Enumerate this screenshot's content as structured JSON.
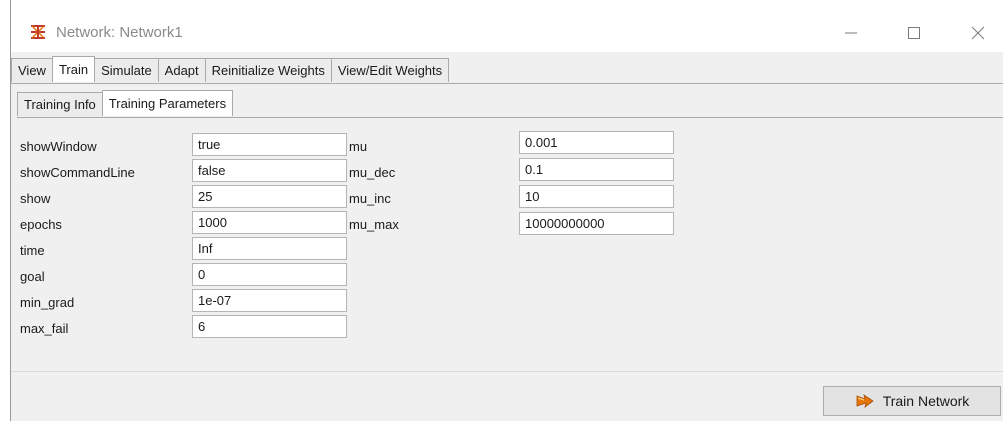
{
  "window": {
    "title": "Network: Network1"
  },
  "tabs": [
    "View",
    "Train",
    "Simulate",
    "Adapt",
    "Reinitialize Weights",
    "View/Edit Weights"
  ],
  "active_tab": "Train",
  "subtabs": [
    "Training Info",
    "Training Parameters"
  ],
  "active_subtab": "Training Parameters",
  "params_left": [
    {
      "label": "showWindow",
      "value": "true"
    },
    {
      "label": "showCommandLine",
      "value": "false"
    },
    {
      "label": "show",
      "value": "25"
    },
    {
      "label": "epochs",
      "value": "1000"
    },
    {
      "label": "time",
      "value": "Inf"
    },
    {
      "label": "goal",
      "value": "0"
    },
    {
      "label": "min_grad",
      "value": "1e-07"
    },
    {
      "label": "max_fail",
      "value": "6"
    }
  ],
  "params_right": [
    {
      "label": "mu",
      "value": "0.001"
    },
    {
      "label": "mu_dec",
      "value": "0.1"
    },
    {
      "label": "mu_inc",
      "value": "10"
    },
    {
      "label": "mu_max",
      "value": "10000000000"
    }
  ],
  "train_button": {
    "label": "Train Network",
    "icon": "train-network-icon"
  },
  "colors": {
    "window_bg": "#f0f0f0",
    "tab_border": "#a9a9a9",
    "field_border": "#b5b5b5",
    "icon_orange": "#e8750a"
  }
}
